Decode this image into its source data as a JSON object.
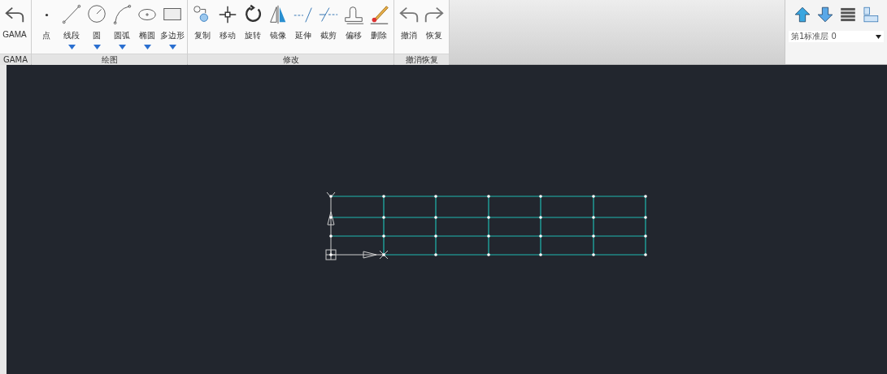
{
  "ribbon": {
    "groups": [
      {
        "label": "GAMA",
        "tools": [
          {
            "label": "GAMA",
            "has_menu": false
          }
        ]
      },
      {
        "label": "绘图",
        "tools": [
          {
            "label": "点",
            "has_menu": false
          },
          {
            "label": "线段",
            "has_menu": true
          },
          {
            "label": "圆",
            "has_menu": true
          },
          {
            "label": "圆弧",
            "has_menu": true
          },
          {
            "label": "椭圆",
            "has_menu": true
          },
          {
            "label": "多边形",
            "has_menu": true
          }
        ]
      },
      {
        "label": "修改",
        "tools": [
          {
            "label": "复制",
            "has_menu": false
          },
          {
            "label": "移动",
            "has_menu": false
          },
          {
            "label": "旋转",
            "has_menu": false
          },
          {
            "label": "镜像",
            "has_menu": false
          },
          {
            "label": "延伸",
            "has_menu": false
          },
          {
            "label": "截剪",
            "has_menu": false
          },
          {
            "label": "偏移",
            "has_menu": false
          },
          {
            "label": "删除",
            "has_menu": false
          }
        ]
      },
      {
        "label": "撤消恢复",
        "tools": [
          {
            "label": "撤消",
            "has_menu": false
          },
          {
            "label": "恢复",
            "has_menu": false
          }
        ]
      }
    ]
  },
  "layers": {
    "value": "第1标准层 0"
  }
}
